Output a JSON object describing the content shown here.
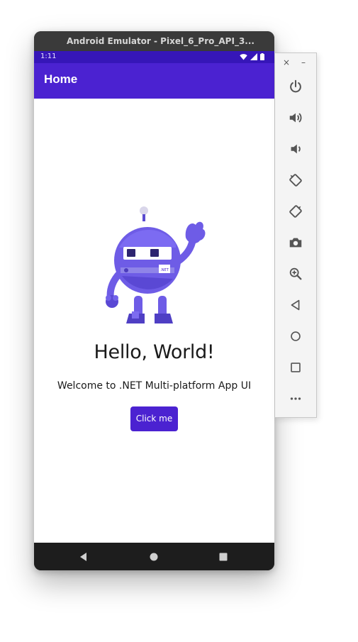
{
  "window": {
    "title": "Android Emulator - Pixel_6_Pro_API_3..."
  },
  "status_bar": {
    "time": "1:11",
    "icons": [
      "wifi-icon",
      "signal-icon",
      "battery-icon"
    ]
  },
  "app_bar": {
    "title": "Home"
  },
  "main": {
    "heading": "Hello, World!",
    "subheading": "Welcome to .NET Multi-platform App UI",
    "button_label": "Click me",
    "mascot_badge": ".NET"
  },
  "nav_bar": {
    "buttons": [
      "back-icon",
      "home-icon",
      "recents-icon"
    ]
  },
  "emulator_toolbar": {
    "close": "×",
    "minimize": "–",
    "buttons": [
      "power-icon",
      "volume-up-icon",
      "volume-down-icon",
      "rotate-left-icon",
      "rotate-right-icon",
      "camera-icon",
      "zoom-icon",
      "back-icon",
      "home-icon",
      "overview-icon",
      "more-icon"
    ]
  },
  "colors": {
    "accent": "#4b22d1",
    "status_bar": "#3616b8",
    "nav_bar": "#1d1d1d",
    "mascot": "#6e5ce6"
  }
}
